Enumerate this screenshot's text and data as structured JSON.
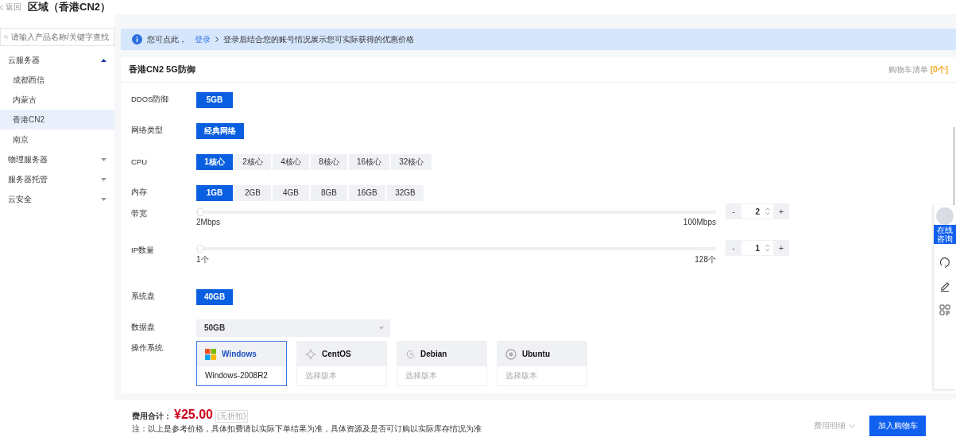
{
  "header": {
    "back": "返回",
    "title": "区域（香港CN2）"
  },
  "sidebar": {
    "search": {
      "placeholder": "请输入产品名称/关键字查找"
    },
    "items": [
      {
        "label": "云服务器",
        "expanded": true,
        "children": [
          {
            "label": "成都西信",
            "selected": false
          },
          {
            "label": "内蒙古",
            "selected": false
          },
          {
            "label": "香港CN2",
            "selected": true
          },
          {
            "label": "南京",
            "selected": false
          }
        ]
      },
      {
        "label": "物理服务器",
        "expanded": false
      },
      {
        "label": "服务器托管",
        "expanded": false
      },
      {
        "label": "云安全",
        "expanded": false
      }
    ]
  },
  "notice": {
    "text": "您可点此，",
    "link": "登录",
    "message": "登录后结合您的账号情况展示您可实际获得的优惠价格"
  },
  "product": {
    "title": "香港CN2 5G防御",
    "cart_label": "购物车清单",
    "cart_count": "[0个]"
  },
  "options": [
    {
      "kind": "buttons",
      "label": "DDOS防御",
      "choices": [
        {
          "label": "5GB",
          "selected": true
        }
      ]
    },
    {
      "kind": "buttons",
      "label": "网络类型",
      "choices": [
        {
          "label": "经典网络",
          "selected": true
        }
      ]
    },
    {
      "kind": "buttons",
      "label": "CPU",
      "choices": [
        {
          "label": "1核心",
          "selected": true
        },
        {
          "label": "2核心",
          "selected": false
        },
        {
          "label": "4核心",
          "selected": false
        },
        {
          "label": "8核心",
          "selected": false
        },
        {
          "label": "16核心",
          "selected": false
        },
        {
          "label": "32核心",
          "selected": false
        }
      ]
    },
    {
      "kind": "buttons",
      "label": "内存",
      "choices": [
        {
          "label": "1GB",
          "selected": true
        },
        {
          "label": "2GB",
          "selected": false
        },
        {
          "label": "4GB",
          "selected": false
        },
        {
          "label": "8GB",
          "selected": false
        },
        {
          "label": "16GB",
          "selected": false
        },
        {
          "label": "32GB",
          "selected": false
        }
      ]
    },
    {
      "kind": "slider",
      "label": "带宽",
      "level": 0,
      "min": "2Mbps",
      "max": "100Mbps",
      "value": "2",
      "minus": "-",
      "plus": "+"
    },
    {
      "kind": "slider",
      "label": "IP数量",
      "level": 0,
      "min": "1个",
      "max": "128个",
      "value": "1",
      "minus": "-",
      "plus": "+"
    },
    {
      "kind": "buttons",
      "label": "系统盘",
      "choices": [
        {
          "label": "40GB",
          "selected": true
        }
      ]
    },
    {
      "kind": "select",
      "label": "数据盘",
      "value": "50GB"
    },
    {
      "kind": "os",
      "label": "操作系统",
      "systems": [
        {
          "kind": "windows",
          "name": "Windows",
          "version": "Windows-2008R2",
          "selected": true
        },
        {
          "kind": "centos",
          "name": "CentOS",
          "version": "选择版本",
          "selected": false
        },
        {
          "kind": "debian",
          "name": "Debian",
          "version": "选择版本",
          "selected": false
        },
        {
          "kind": "ubuntu",
          "name": "Ubuntu",
          "version": "选择版本",
          "selected": false
        }
      ]
    }
  ],
  "footer": {
    "total_label": "费用合计：",
    "price": "¥25.00",
    "discount": "(无折扣)",
    "note": "注：以上是参考价格，具体扣费请以实际下单结果为准，具体资源及是否可订购以实际库存情况为准",
    "details": "费用明细",
    "add_button": "加入购物车"
  },
  "float_bar": {
    "consult": "在线咨询"
  }
}
